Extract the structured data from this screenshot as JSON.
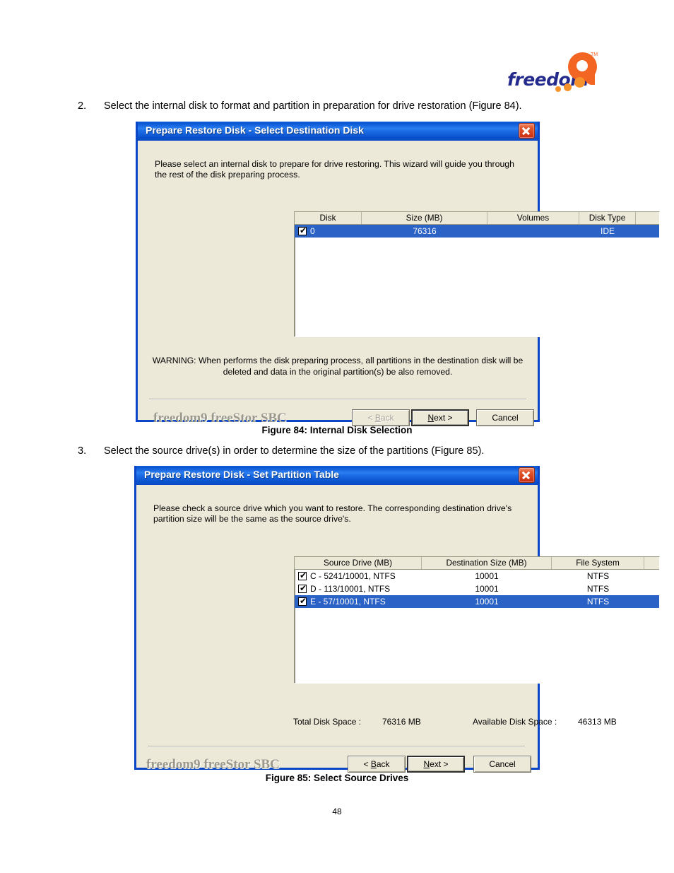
{
  "page": {
    "number": "48"
  },
  "logo": {
    "word": "freedom",
    "tm": "TM"
  },
  "steps": [
    {
      "num": "2.",
      "text": "Select the internal disk to format and partition in preparation for drive restoration (Figure 84)."
    },
    {
      "num": "3.",
      "text": "Select the source drive(s) in order to determine the size of the partitions (Figure 85)."
    }
  ],
  "captions": {
    "fig84": "Figure 84: Internal Disk Selection",
    "fig85": "Figure 85: Select Source Drives"
  },
  "dialog1": {
    "title": "Prepare Restore Disk - Select Destination Disk",
    "close_label": "close-icon",
    "intro": "Please select an internal disk to prepare for drive restoring. This wizard will guide you through the rest of the disk preparing process.",
    "columns": [
      "Disk",
      "Size (MB)",
      "Volumes",
      "Disk Type",
      ""
    ],
    "rows": [
      {
        "checked": true,
        "selected": true,
        "disk": "0",
        "size": "76316",
        "volumes": "",
        "disk_type": "IDE"
      }
    ],
    "warning_line1": "WARNING: When performs the disk preparing process, all partitions in the destination disk will be",
    "warning_line2": "deleted and data in the original partition(s) be also removed.",
    "brand": "freedom9 freeStor SBC",
    "buttons": {
      "back": "< Back",
      "back_enabled": false,
      "next": "Next >",
      "next_mnemonic": "N",
      "cancel": "Cancel"
    }
  },
  "dialog2": {
    "title": "Prepare Restore Disk - Set Partition Table",
    "close_label": "close-icon",
    "intro": "Please check a source drive which you want to restore. The corresponding destination drive's partition size will be the same as the source drive's.",
    "columns": [
      "Source Drive (MB)",
      "Destination Size (MB)",
      "File System",
      ""
    ],
    "rows": [
      {
        "checked": true,
        "selected": false,
        "source_drive": "C - 5241/10001, NTFS",
        "destination_size": "10001",
        "file_system": "NTFS"
      },
      {
        "checked": true,
        "selected": false,
        "source_drive": "D - 113/10001, NTFS",
        "destination_size": "10001",
        "file_system": "NTFS"
      },
      {
        "checked": true,
        "selected": true,
        "source_drive": "E - 57/10001, NTFS",
        "destination_size": "10001",
        "file_system": "NTFS"
      }
    ],
    "total_label": "Total Disk Space :",
    "total_value": "76316 MB",
    "available_label": "Available Disk Space :",
    "available_value": "46313 MB",
    "brand": "freedom9 freeStor SBC",
    "buttons": {
      "back": "< Back",
      "back_enabled": true,
      "back_mnemonic": "B",
      "next": "Next >",
      "next_mnemonic": "N",
      "cancel": "Cancel"
    }
  },
  "colors": {
    "titlebar_blue": "#1a6ae4",
    "dialog_face": "#ece9d8",
    "selection_blue": "#2a62c6",
    "logo_blue": "#232a8c",
    "logo_orange": "#f26522"
  }
}
